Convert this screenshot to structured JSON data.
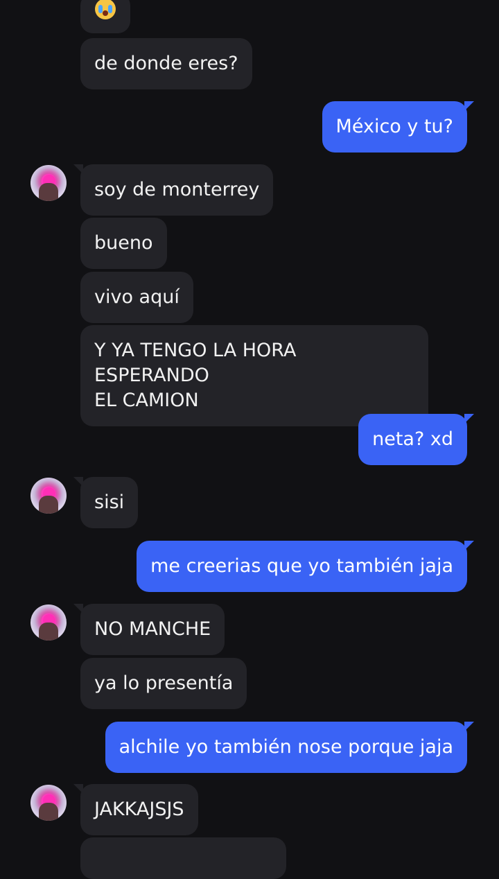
{
  "messages": {
    "m1": {
      "emoji": "crying-face-icon"
    },
    "m2": "de donde eres?",
    "m3": "México y tu?",
    "m4": "soy de monterrey",
    "m5": "bueno",
    "m6": "vivo aquí",
    "m7": "Y YA TENGO LA HORA ESPERANDO\nEL CAMION",
    "m8": "neta? xd",
    "m9": "sisi",
    "m10": "me creerias que yo también jaja",
    "m11": "NO MANCHE",
    "m12": "ya lo presentía",
    "m13": "alchile yo también nose porque jaja",
    "m14": "JAKKAJSJS"
  },
  "colors": {
    "background": "#111114",
    "incoming_bubble": "#232328",
    "outgoing_bubble": "#3a63f5"
  }
}
